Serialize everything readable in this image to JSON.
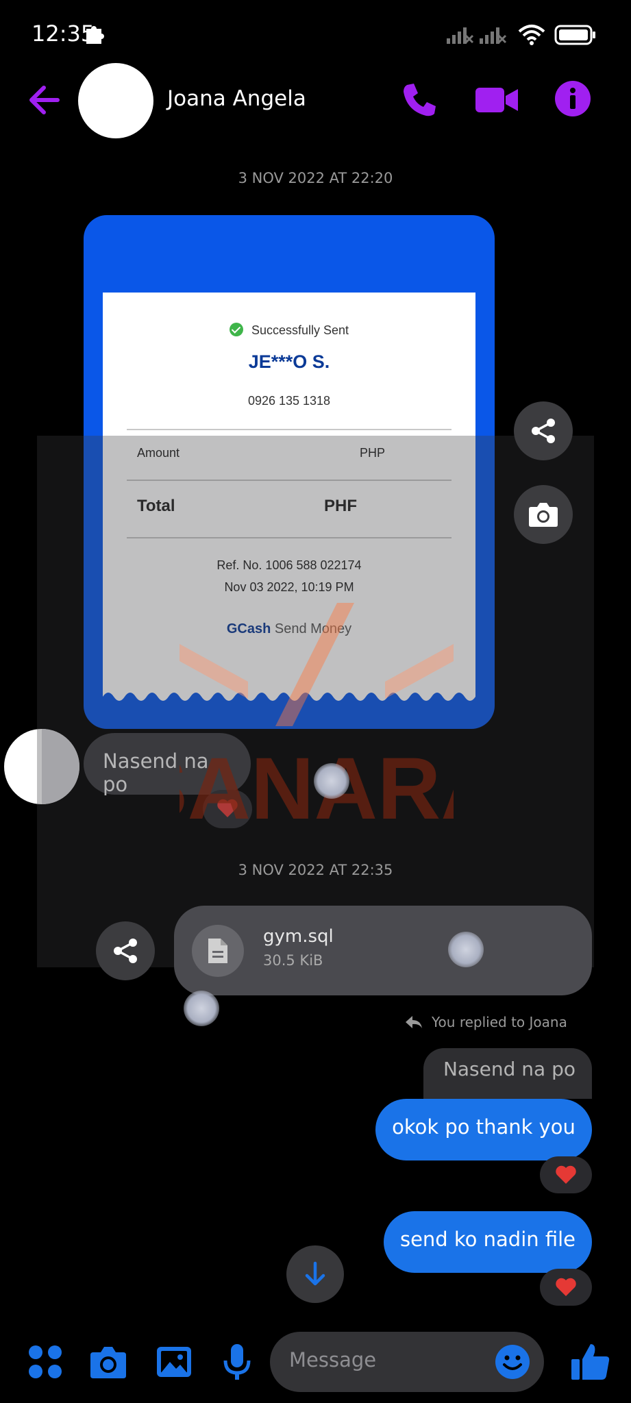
{
  "status_bar": {
    "time": "12:35"
  },
  "header": {
    "contact_name": "Joana Angela"
  },
  "timestamps": [
    "3 NOV 2022 AT 22:20",
    "3 NOV 2022 AT 22:35"
  ],
  "receipt": {
    "status": "Successfully Sent",
    "recipient": "JE***O S.",
    "phone": "0926 135 1318",
    "amount_label": "Amount",
    "amount_value": "PHP",
    "total_label": "Total",
    "total_value": "PHF",
    "ref": "Ref. No. 1006 588 022174",
    "date": "Nov 03 2022, 10:19 PM",
    "brand_bold": "GCash",
    "brand_rest": " Send Money"
  },
  "watermark": {
    "text": "SANARA"
  },
  "messages": {
    "incoming_text": "Nasend na po",
    "file_name": "gym.sql",
    "file_size": "30.5 KiB",
    "reply_indicator": "You replied to Joana",
    "quoted_text": "Nasend na po",
    "outgoing_1": "okok po thank you",
    "outgoing_2": "send ko nadin file"
  },
  "composer": {
    "placeholder": "Message"
  },
  "colors": {
    "accent_purple": "#a020f0",
    "accent_blue": "#1a73e8",
    "heart_red": "#e53935"
  }
}
